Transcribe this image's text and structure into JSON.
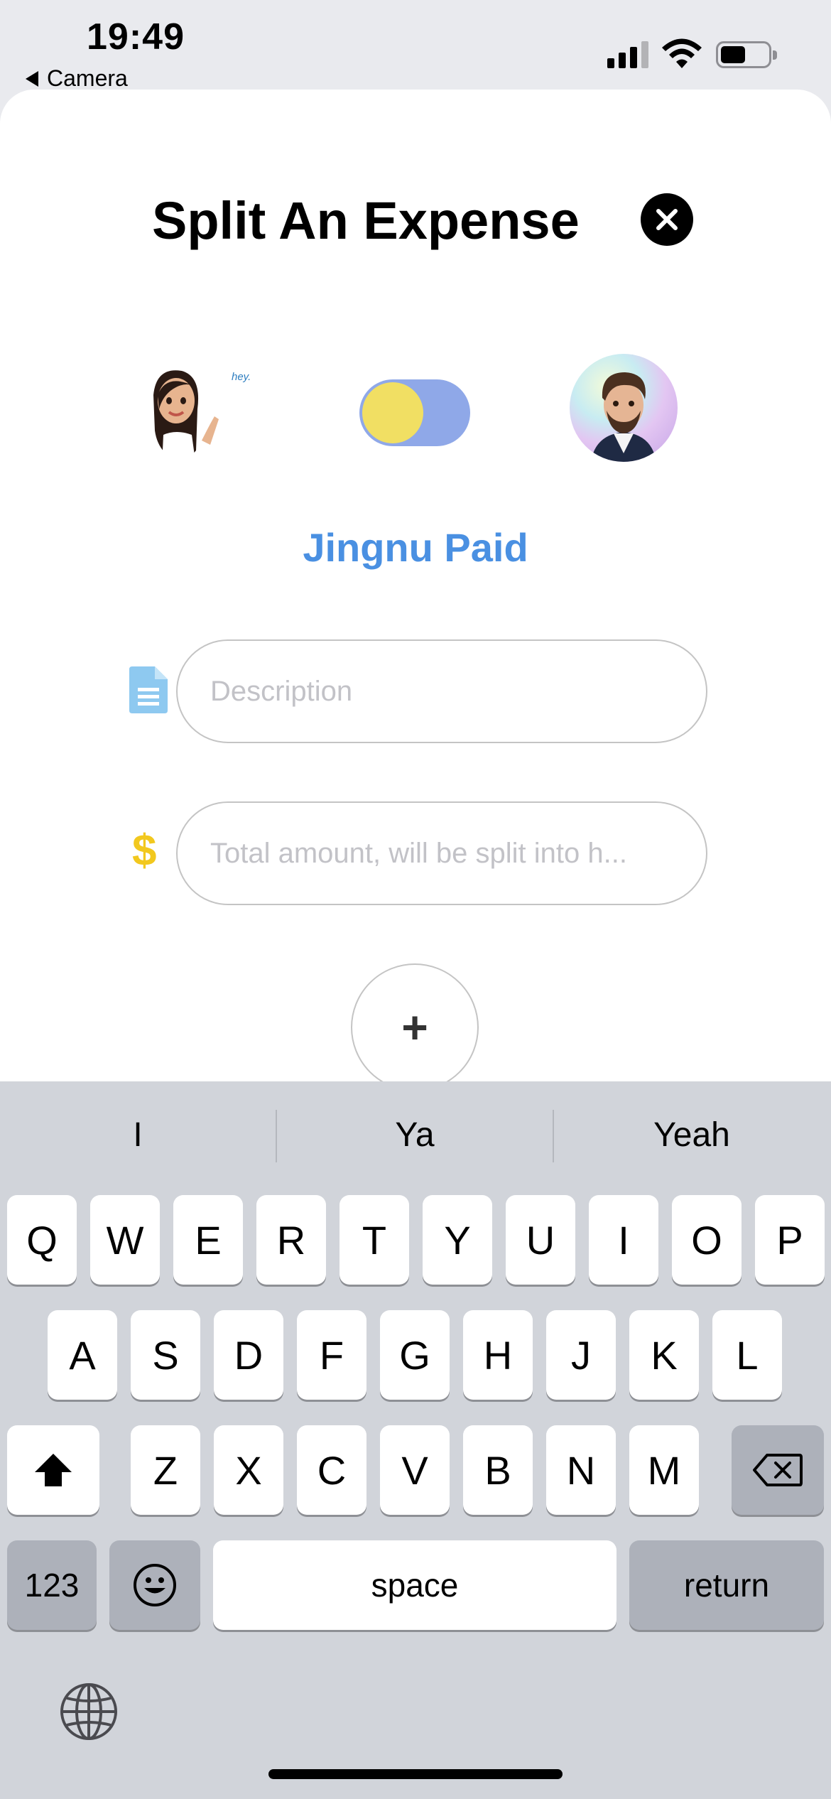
{
  "status_bar": {
    "time": "19:49",
    "back_label": "Camera"
  },
  "sheet": {
    "title": "Split An Expense",
    "sticker_text": "hey.",
    "payer_label": "Jingnu Paid",
    "toggle_on": true,
    "description": {
      "value": "",
      "placeholder": "Description"
    },
    "amount": {
      "value": "",
      "placeholder": "Total amount, will be split into h..."
    },
    "add_button_label": "+"
  },
  "keyboard": {
    "suggestions": [
      "I",
      "Ya",
      "Yeah"
    ],
    "row1": [
      "Q",
      "W",
      "E",
      "R",
      "T",
      "Y",
      "U",
      "I",
      "O",
      "P"
    ],
    "row2": [
      "A",
      "S",
      "D",
      "F",
      "G",
      "H",
      "J",
      "K",
      "L"
    ],
    "row3": [
      "Z",
      "X",
      "C",
      "V",
      "B",
      "N",
      "M"
    ],
    "numbers_key": "123",
    "space_key": "space",
    "return_key": "return"
  },
  "colors": {
    "accent_blue": "#4a90e2",
    "toggle_track": "#8fa8e8",
    "toggle_knob": "#f1df63",
    "dollar_yellow": "#f2c81e",
    "doc_icon_blue": "#8ec9f0"
  }
}
